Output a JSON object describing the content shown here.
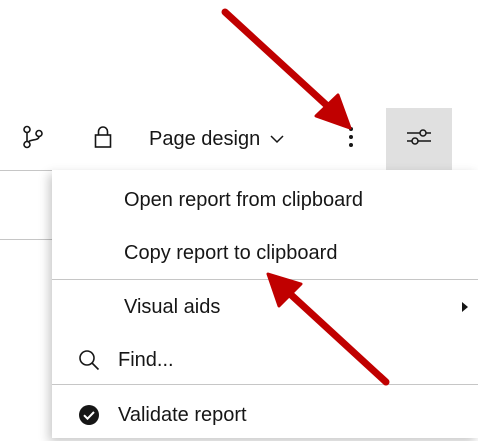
{
  "toolbar": {
    "branch_icon": "branch-icon",
    "lock_icon": "lock-icon",
    "page_design_label": "Page design",
    "chevron_icon": "chevron-down-icon",
    "more_icon": "overflow-menu-vertical-icon",
    "properties_icon": "settings-adjust-icon"
  },
  "menu": {
    "items": [
      {
        "label": "Open report from clipboard"
      },
      {
        "label": "Copy report to clipboard"
      },
      {
        "label": "Visual aids",
        "submenu_icon": "caret-right-icon"
      },
      {
        "label": "Find...",
        "icon": "search-icon"
      },
      {
        "label": "Validate report",
        "icon": "checkmark-filled-icon"
      }
    ]
  },
  "colors": {
    "annotation_arrow": "#c00000",
    "active_button_bg": "#e0e0e0",
    "text": "#161616",
    "divider": "#c6c6c6"
  }
}
